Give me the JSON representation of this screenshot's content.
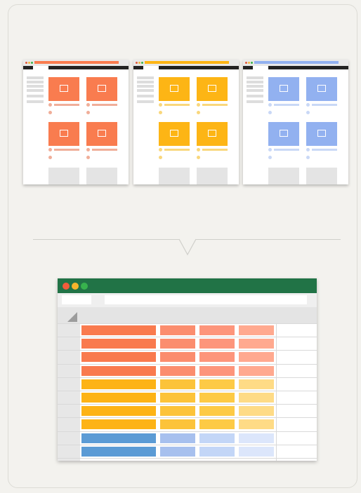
{
  "colors": {
    "background": "#f3f2ee",
    "orange": "#f97c4f",
    "yellow": "#fdb515",
    "blue": "#92b1f0",
    "excel_green": "#217346"
  },
  "icons": [
    "image-icon",
    "window-dot-icon",
    "select-all-triangle-icon"
  ],
  "mockups": [
    {
      "theme": "orange",
      "accent": "#f97c4f",
      "caption": "#f0ae99"
    },
    {
      "theme": "yellow",
      "accent": "#fdb515",
      "caption": "#f9d77c"
    },
    {
      "theme": "blue",
      "accent": "#92b1f0",
      "caption": "#c9d8f6"
    }
  ],
  "spreadsheet": {
    "window_dots": [
      "#f25c3b",
      "#f7b52c",
      "#37b24d"
    ],
    "rows": [
      {
        "group": "orange",
        "colors": [
          "#f97a4e",
          "#fb8d6e",
          "#fd957b",
          "#ffa98f"
        ]
      },
      {
        "group": "orange",
        "colors": [
          "#f97a4e",
          "#fb8d6e",
          "#fd957b",
          "#ffa98f"
        ]
      },
      {
        "group": "orange",
        "colors": [
          "#f97a4e",
          "#fb8d6e",
          "#fd957b",
          "#ffa98f"
        ]
      },
      {
        "group": "orange",
        "colors": [
          "#f97a4e",
          "#fb8d6e",
          "#fd957b",
          "#ffa98f"
        ]
      },
      {
        "group": "yellow",
        "colors": [
          "#fdb316",
          "#fcc33a",
          "#fdca45",
          "#fedb86"
        ]
      },
      {
        "group": "yellow",
        "colors": [
          "#fdb316",
          "#fcc33a",
          "#fdca45",
          "#fedb86"
        ]
      },
      {
        "group": "yellow",
        "colors": [
          "#fdb316",
          "#fcc33a",
          "#fdca45",
          "#fedb86"
        ]
      },
      {
        "group": "yellow",
        "colors": [
          "#fdb316",
          "#fcc33a",
          "#fdca45",
          "#fedb86"
        ]
      },
      {
        "group": "blue",
        "colors": [
          "#5b9bd5",
          "#a7c0ee",
          "#c3d6f7",
          "#dce6fb"
        ]
      },
      {
        "group": "blue",
        "colors": [
          "#5b9bd5",
          "#a7c0ee",
          "#c3d6f7",
          "#dce6fb"
        ]
      }
    ]
  }
}
